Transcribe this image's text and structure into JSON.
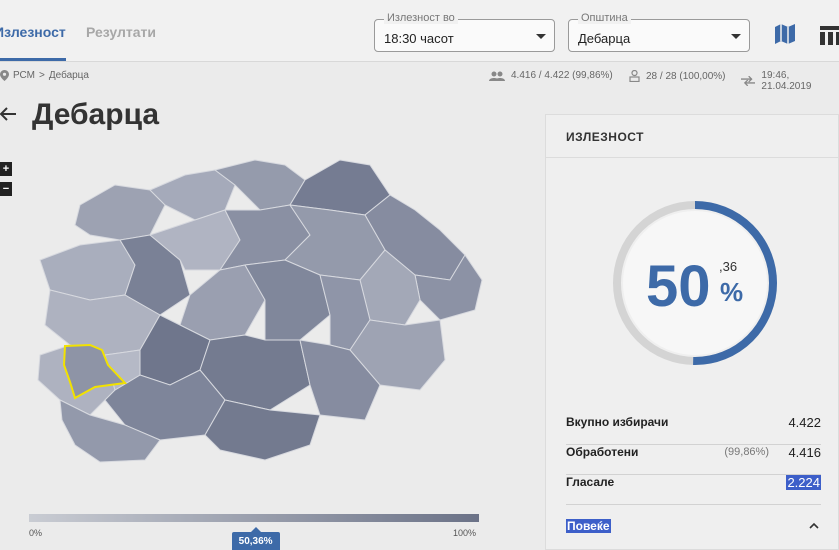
{
  "header": {
    "tabs": [
      {
        "label": "Излезност",
        "active": true
      },
      {
        "label": "Резултати",
        "active": false
      }
    ],
    "time_select": {
      "label": "Излезност во",
      "value": "18:30 часот"
    },
    "municipality_select": {
      "label": "Општина",
      "value": "Дебарца"
    },
    "icons": [
      "map-view-icon",
      "table-view-icon"
    ]
  },
  "breadcrumb": {
    "root": "РСМ",
    "separator": ">",
    "current": "Дебарца"
  },
  "stats": {
    "voters": "4.416 / 4.422 (99,86%)",
    "stations": "28 / 28 (100,00%)",
    "updated": "19:46, 21.04.2019"
  },
  "page": {
    "title": "Дебарца"
  },
  "map": {
    "zoom_in": "+",
    "zoom_out": "−",
    "highlighted_region": "Дебарца",
    "slider": {
      "min_label": "0%",
      "max_label": "100%",
      "current_label": "50,36%",
      "current": 50.36
    }
  },
  "panel": {
    "title": "ИЗЛЕЗНОСТ",
    "turnout": {
      "integer": "50",
      "decimal": ",36",
      "sign": "%",
      "fraction": 0.5036
    },
    "rows": [
      {
        "label": "Вкупно избирачи",
        "sub": "",
        "value": "4.422"
      },
      {
        "label": "Обработени",
        "sub": "(99,86%)",
        "value": "4.416"
      },
      {
        "label": "Гласале",
        "sub": "",
        "value": "2.224"
      }
    ],
    "more_label": "Повеќе"
  },
  "colors": {
    "accent": "#3d6aa8",
    "highlight": "#f2e200",
    "region": "#8e94a6",
    "selection": "#3d5fc9"
  }
}
